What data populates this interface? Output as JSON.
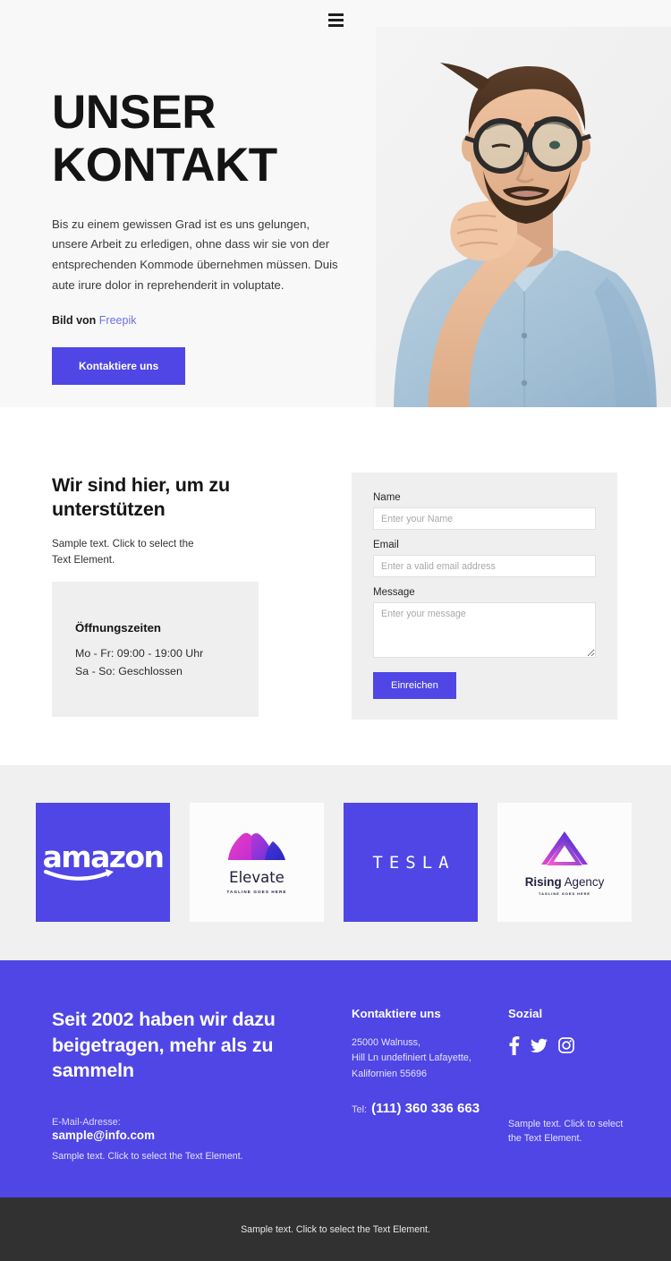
{
  "nav": {
    "menu_icon": "hamburger-menu-icon"
  },
  "hero": {
    "title_line1": "UNSER",
    "title_line2": "KONTAKT",
    "paragraph": "Bis zu einem gewissen Grad ist es uns gelungen, unsere Arbeit zu erledigen, ohne dass wir sie von der entsprechenden Kommode übernehmen müssen. Duis aute irure dolor in reprehenderit in voluptate.",
    "credit_prefix": "Bild von",
    "credit_link": "Freepik",
    "cta_label": "Kontaktiere uns",
    "image_alt": "bearded-man-with-glasses-thinking"
  },
  "contact": {
    "heading": "Wir sind hier, um zu unterstützen",
    "subtext": "Sample text. Click to select the Text Element.",
    "hours": {
      "title": "Öffnungszeiten",
      "line1": "Mo - Fr: 09:00 - 19:00 Uhr",
      "line2": "Sa - So: Geschlossen"
    },
    "form": {
      "name_label": "Name",
      "name_placeholder": "Enter your Name",
      "name_value": "",
      "email_label": "Email",
      "email_placeholder": "Enter a valid email address",
      "email_value": "",
      "message_label": "Message",
      "message_placeholder": "Enter your message",
      "message_value": "",
      "submit_label": "Einreichen"
    }
  },
  "logos": [
    {
      "name": "amazon",
      "word": "amazon",
      "style": "purple"
    },
    {
      "name": "Elevate",
      "word": "Elevate",
      "tagline": "TAGLINE GOES HERE",
      "style": "white"
    },
    {
      "name": "TESLA",
      "word": "TESLA",
      "style": "purple"
    },
    {
      "name": "Rising Agency",
      "word_bold": "Rising",
      "word_light": "Agency",
      "tagline": "TAGLINE GOES HERE",
      "style": "white"
    }
  ],
  "footer": {
    "heading": "Seit 2002 haben wir dazu beigetragen, mehr als zu sammeln",
    "email_label": "E-Mail-Adresse:",
    "email_value": "sample@info.com",
    "note_left": "Sample text. Click to select the Text Element.",
    "contact_title": "Kontaktiere uns",
    "address_line1": "25000 Walnuss,",
    "address_line2": "Hill Ln undefiniert Lafayette,",
    "address_line3": "Kalifornien 55696",
    "tel_label": "Tel:",
    "tel_value": "(111) 360 336 663",
    "social_title": "Sozial",
    "social_icons": [
      "facebook-icon",
      "twitter-icon",
      "instagram-icon"
    ],
    "note_right": "Sample text. Click to select the Text Element."
  },
  "bottombar": {
    "text": "Sample text. Click to select the Text Element."
  },
  "colors": {
    "accent": "#4f46e5",
    "hero_bg": "#f8f8f8",
    "panel_gray": "#efefef",
    "logos_bg": "#f0f0f0",
    "bottombar_bg": "#313131",
    "link": "#6f6fe0"
  }
}
